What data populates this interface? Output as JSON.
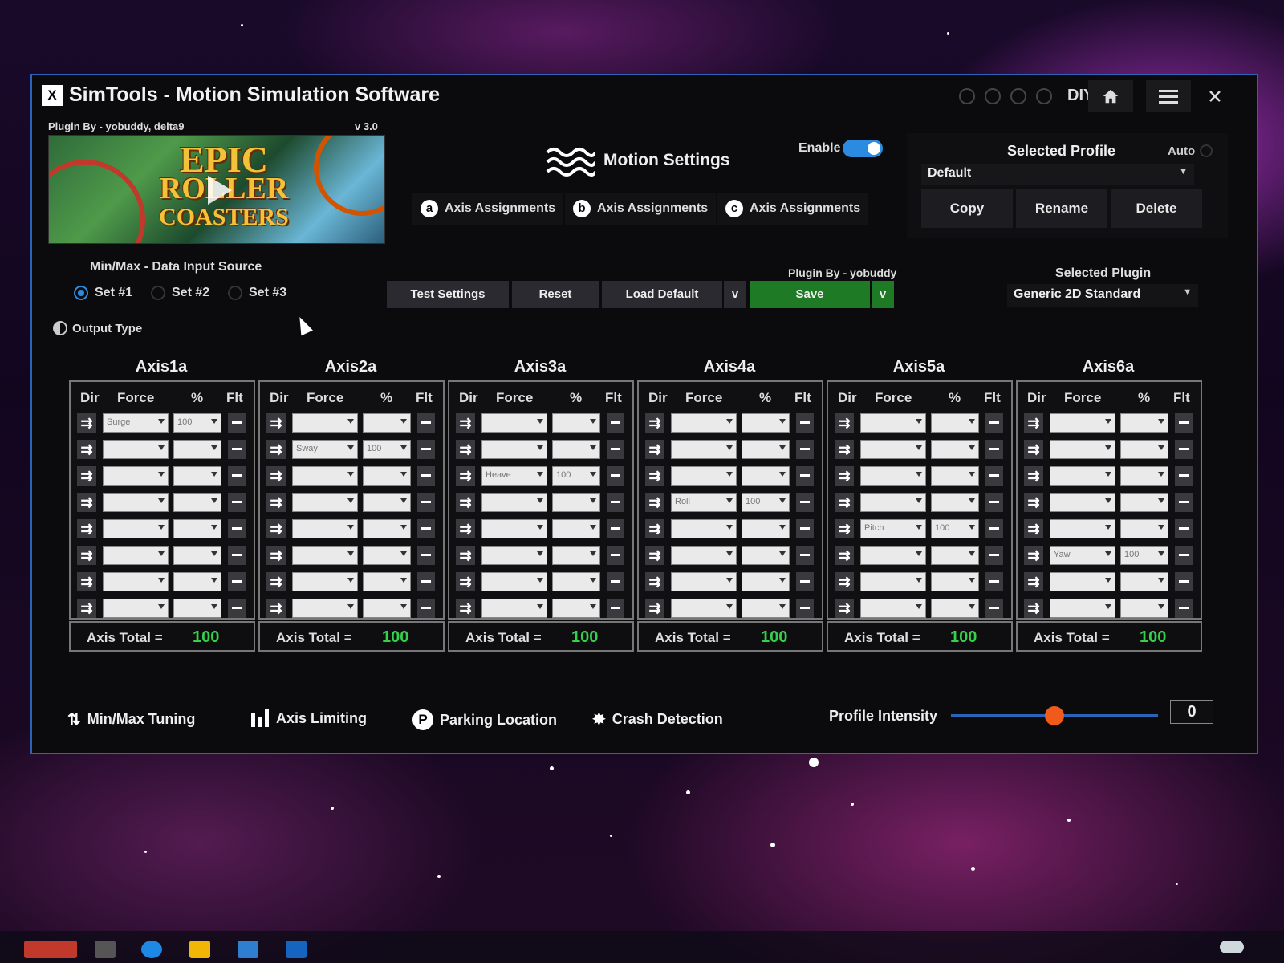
{
  "window": {
    "title": "SimTools - Motion Simulation Software",
    "logo_text": "X",
    "diy_label": "DIY",
    "home_icon": "home-icon",
    "menu_icon": "menu-icon",
    "close_icon": "close-icon"
  },
  "game": {
    "plugin_by": "Plugin By - yobuddy, delta9",
    "version": "v 3.0",
    "banner_line1": "EPIC",
    "banner_line2": "ROLLER",
    "banner_line3": "COASTERS"
  },
  "motion": {
    "title": "Motion Settings",
    "enable_label": "Enable",
    "enabled": true,
    "axis_assign_tabs": [
      {
        "letter": "a",
        "label": "Axis Assignments"
      },
      {
        "letter": "b",
        "label": "Axis Assignments"
      },
      {
        "letter": "c",
        "label": "Axis Assignments"
      }
    ]
  },
  "profile": {
    "label": "Selected Profile",
    "auto_label": "Auto",
    "value": "Default",
    "copy": "Copy",
    "rename": "Rename",
    "delete": "Delete"
  },
  "minmax": {
    "title": "Min/Max - Data Input Source",
    "sets": [
      "Set #1",
      "Set #2",
      "Set #3"
    ],
    "selected": 0,
    "output_type": "Output Type"
  },
  "toolbar": {
    "plugin_by": "Plugin By - yobuddy",
    "test_settings": "Test Settings",
    "reset": "Reset",
    "load_default": "Load Default",
    "save": "Save",
    "chevron": "v"
  },
  "plugin": {
    "label": "Selected Plugin",
    "value": "Generic 2D Standard"
  },
  "axis_columns": {
    "dir": "Dir",
    "force": "Force",
    "pct": "%",
    "flt": "Flt"
  },
  "axes": [
    {
      "name": "Axis1a",
      "total_label": "Axis Total =",
      "total": "100",
      "rows": [
        [
          "Surge",
          "100"
        ],
        [
          "",
          ""
        ],
        [
          "",
          ""
        ],
        [
          "",
          ""
        ],
        [
          "",
          ""
        ],
        [
          "",
          ""
        ],
        [
          "",
          ""
        ],
        [
          "",
          ""
        ]
      ]
    },
    {
      "name": "Axis2a",
      "total_label": "Axis Total =",
      "total": "100",
      "rows": [
        [
          "",
          ""
        ],
        [
          "Sway",
          "100"
        ],
        [
          "",
          ""
        ],
        [
          "",
          ""
        ],
        [
          "",
          ""
        ],
        [
          "",
          ""
        ],
        [
          "",
          ""
        ],
        [
          "",
          ""
        ]
      ]
    },
    {
      "name": "Axis3a",
      "total_label": "Axis Total =",
      "total": "100",
      "rows": [
        [
          "",
          ""
        ],
        [
          "",
          ""
        ],
        [
          "Heave",
          "100"
        ],
        [
          "",
          ""
        ],
        [
          "",
          ""
        ],
        [
          "",
          ""
        ],
        [
          "",
          ""
        ],
        [
          "",
          ""
        ]
      ]
    },
    {
      "name": "Axis4a",
      "total_label": "Axis Total =",
      "total": "100",
      "rows": [
        [
          "",
          ""
        ],
        [
          "",
          ""
        ],
        [
          "",
          ""
        ],
        [
          "Roll",
          "100"
        ],
        [
          "",
          ""
        ],
        [
          "",
          ""
        ],
        [
          "",
          ""
        ],
        [
          "",
          ""
        ]
      ]
    },
    {
      "name": "Axis5a",
      "total_label": "Axis Total =",
      "total": "100",
      "rows": [
        [
          "",
          ""
        ],
        [
          "",
          ""
        ],
        [
          "",
          ""
        ],
        [
          "",
          ""
        ],
        [
          "Pitch",
          "100"
        ],
        [
          "",
          ""
        ],
        [
          "",
          ""
        ],
        [
          "",
          ""
        ]
      ]
    },
    {
      "name": "Axis6a",
      "total_label": "Axis Total =",
      "total": "100",
      "rows": [
        [
          "",
          ""
        ],
        [
          "",
          ""
        ],
        [
          "",
          ""
        ],
        [
          "",
          ""
        ],
        [
          "",
          ""
        ],
        [
          "Yaw",
          "100"
        ],
        [
          "",
          ""
        ],
        [
          "",
          ""
        ]
      ]
    }
  ],
  "bottom": {
    "minmax_tuning": "Min/Max Tuning",
    "axis_limiting": "Axis Limiting",
    "parking_location": "Parking Location",
    "parking_letter": "P",
    "crash_detection": "Crash Detection",
    "profile_intensity": "Profile Intensity",
    "intensity_value": "0",
    "intensity_fraction": 0.5
  },
  "colors": {
    "accent_blue": "#2a8be0",
    "save_green": "#1e7a25",
    "total_green": "#35d14a",
    "slider_thumb": "#f05a1a"
  }
}
